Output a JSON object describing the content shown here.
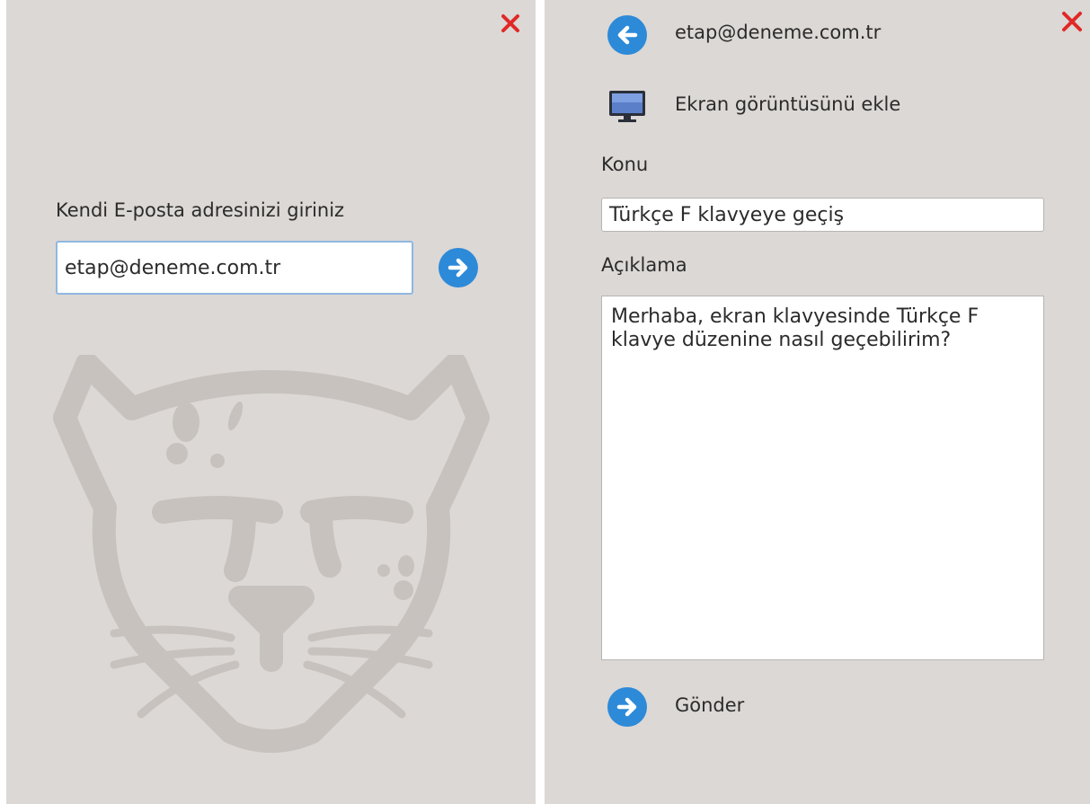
{
  "left": {
    "email_prompt": "Kendi E-posta adresinizi giriniz",
    "email_value": "etap@deneme.com.tr",
    "close_icon": "close-icon",
    "next_icon": "arrow-right-icon",
    "mascot": "pardus-cheetah-watermark"
  },
  "right": {
    "account_email": "etap@deneme.com.tr",
    "back_icon": "arrow-left-icon",
    "add_screenshot_label": "Ekran görüntüsünü ekle",
    "subject_label": "Konu",
    "subject_value": "Türkçe F klavyeye geçiş",
    "description_label": "Açıklama",
    "description_value": "Merhaba, ekran klavyesinde Türkçe F klavye düzenine nasıl geçebilirim?",
    "send_label": "Gönder",
    "close_icon": "close-icon"
  },
  "colors": {
    "panel_bg": "#dcd8d5",
    "accent_blue": "#2d8ad8",
    "close_red": "#e02828",
    "mascot_gray": "#c7c2bd"
  }
}
